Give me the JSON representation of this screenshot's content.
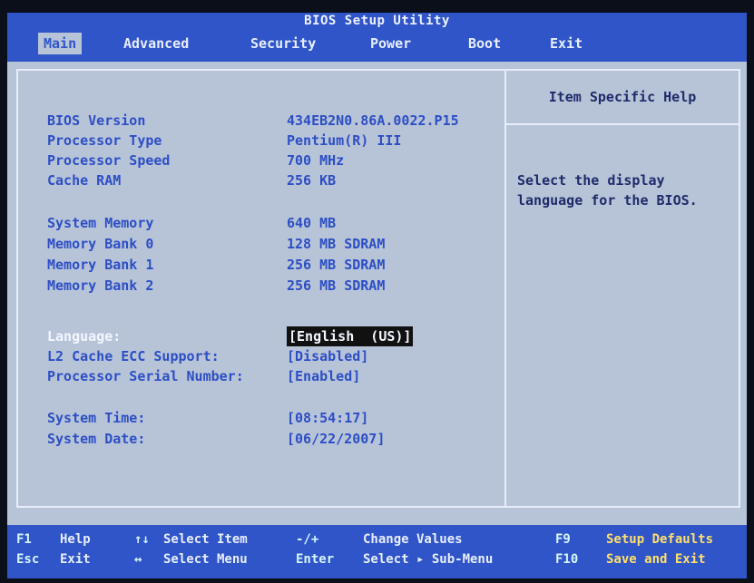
{
  "title": "BIOS Setup Utility",
  "tabs": [
    {
      "label": "Main",
      "active": true
    },
    {
      "label": "Advanced",
      "active": false
    },
    {
      "label": "Security",
      "active": false
    },
    {
      "label": "Power",
      "active": false
    },
    {
      "label": "Boot",
      "active": false
    },
    {
      "label": "Exit",
      "active": false
    }
  ],
  "main": {
    "info": [
      {
        "label": "BIOS Version",
        "value": "434EB2N0.86A.0022.P15"
      },
      {
        "label": "Processor Type",
        "value": "Pentium(R) III"
      },
      {
        "label": "Processor Speed",
        "value": "700 MHz"
      },
      {
        "label": "Cache RAM",
        "value": "256 KB"
      },
      {
        "label": "System Memory",
        "value": "640 MB"
      },
      {
        "label": "Memory Bank 0",
        "value": "128 MB SDRAM"
      },
      {
        "label": "Memory Bank 1",
        "value": "256 MB SDRAM"
      },
      {
        "label": "Memory Bank 2",
        "value": "256 MB SDRAM"
      }
    ],
    "settings": [
      {
        "label": "Language:",
        "value": "[English  (US)]",
        "selected": true
      },
      {
        "label": "L2 Cache ECC Support:",
        "value": "[Disabled]"
      },
      {
        "label": "Processor Serial Number:",
        "value": "[Enabled]"
      },
      {
        "label": "System Time:",
        "value": "[08:54:17]"
      },
      {
        "label": "System Date:",
        "value": "[06/22/2007]"
      }
    ]
  },
  "help": {
    "title": "Item Specific Help",
    "text": "Select the display language for the BIOS."
  },
  "footer": {
    "keys": [
      {
        "key": "F1",
        "action": "Help"
      },
      {
        "key": "Esc",
        "action": "Exit"
      },
      {
        "key": "↑↓",
        "action": "Select Item"
      },
      {
        "key": "↔",
        "action": "Select Menu"
      },
      {
        "key": "-/+",
        "action": "Change Values"
      },
      {
        "key": "Enter",
        "action": "Select ▸ Sub-Menu"
      },
      {
        "key": "F9",
        "action": "Setup Defaults"
      },
      {
        "key": "F10",
        "action": "Save and Exit"
      }
    ]
  },
  "colors": {
    "blue_bar": "#2f55c8",
    "panel_bg": "#b7c4d8",
    "text_blue": "#2d4ec4",
    "highlight_white": "#f3f7ff",
    "footer_highlight": "#ffe06a"
  }
}
